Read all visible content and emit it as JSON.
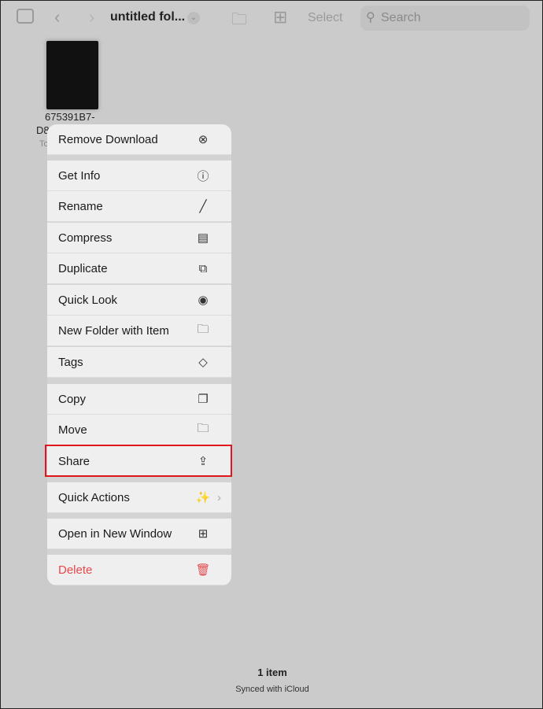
{
  "toolbar": {
    "title": "untitled fol...",
    "select_label": "Select",
    "search_placeholder": "Search"
  },
  "file": {
    "name_line1": "675391B7-",
    "name_line2": "D8",
    "sub": "To"
  },
  "menu": {
    "items": [
      {
        "label": "Remove Download",
        "icon": "xmark-circle-icon",
        "glyph": "⊗"
      },
      {
        "label": "Get Info",
        "icon": "info-circle-icon",
        "glyph": "ⓘ"
      },
      {
        "label": "Rename",
        "icon": "pencil-icon",
        "glyph": "╱"
      },
      {
        "label": "Compress",
        "icon": "archive-box-icon",
        "glyph": "▤"
      },
      {
        "label": "Duplicate",
        "icon": "plus-square-on-square-icon",
        "glyph": "⧉"
      },
      {
        "label": "Quick Look",
        "icon": "eye-icon",
        "glyph": "◉"
      },
      {
        "label": "New Folder with Item",
        "icon": "folder-badge-plus-icon",
        "glyph": "🗀"
      },
      {
        "label": "Tags",
        "icon": "tag-icon",
        "glyph": "◇"
      },
      {
        "label": "Copy",
        "icon": "doc-on-doc-icon",
        "glyph": "❐"
      },
      {
        "label": "Move",
        "icon": "folder-icon",
        "glyph": "🗀"
      },
      {
        "label": "Share",
        "icon": "share-icon",
        "glyph": "⇪"
      },
      {
        "label": "Quick Actions",
        "icon": "magic-wand-icon",
        "glyph": "✨"
      },
      {
        "label": "Open in New Window",
        "icon": "grid-icon",
        "glyph": "⊞"
      },
      {
        "label": "Delete",
        "icon": "trash-icon",
        "glyph": "🗑"
      }
    ]
  },
  "highlight_color": "#e0161e",
  "footer": {
    "count": "1 item",
    "sync": "Synced with iCloud"
  }
}
